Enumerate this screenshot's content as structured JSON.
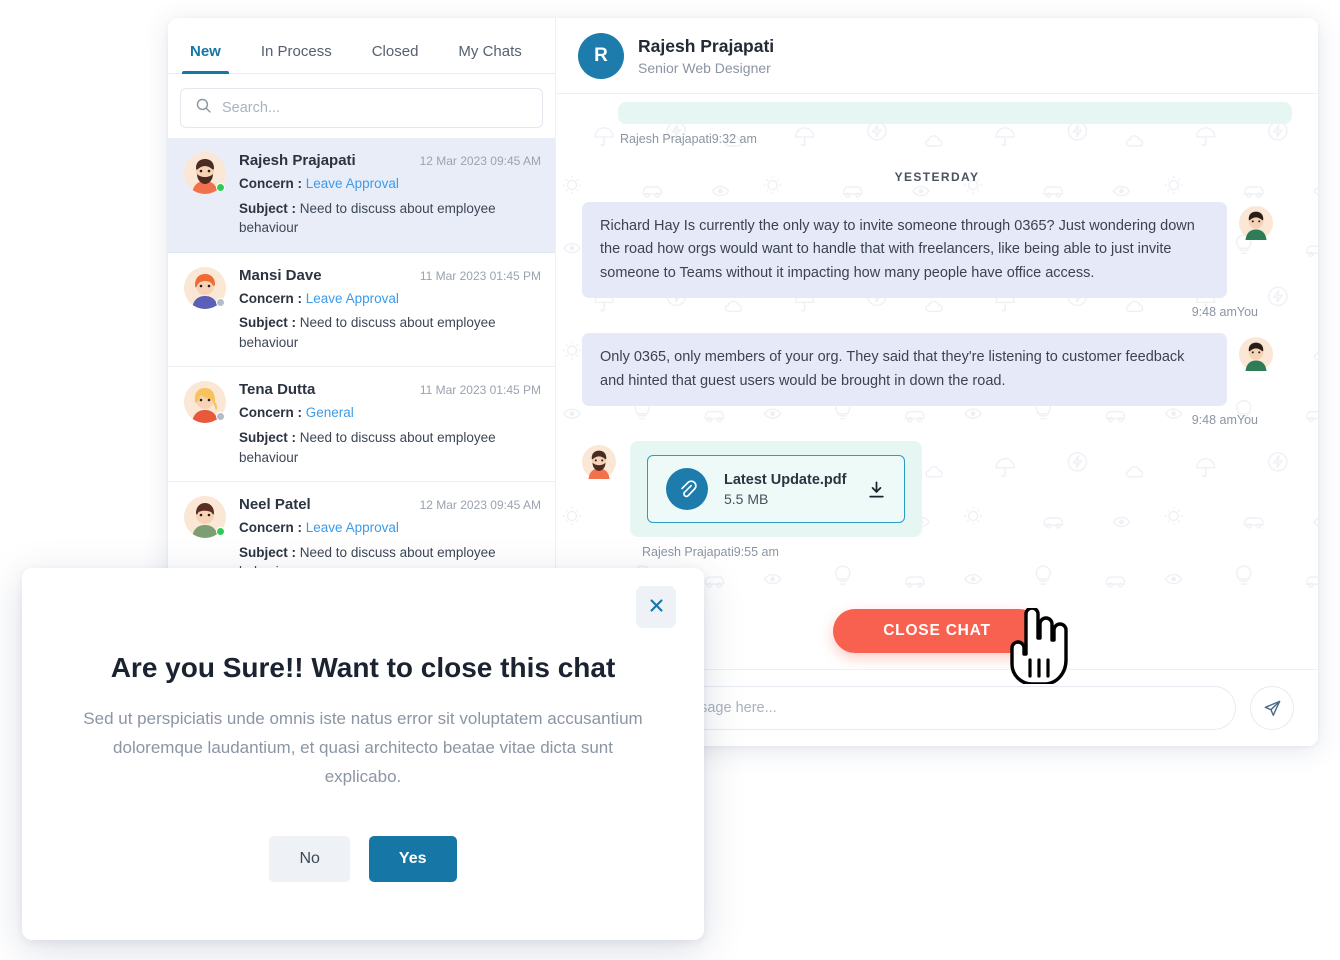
{
  "tabs": [
    {
      "label": "New",
      "active": true
    },
    {
      "label": "In Process",
      "active": false
    },
    {
      "label": "Closed",
      "active": false
    },
    {
      "label": "My Chats",
      "active": false
    }
  ],
  "search": {
    "placeholder": "Search...",
    "value": "",
    "icon": "search-icon"
  },
  "chat_list": {
    "concern_label": "Concern :",
    "subject_label": "Subject :",
    "items": [
      {
        "name": "Rajesh Prajapati",
        "time": "12 Mar 2023 09:45 AM",
        "concern": "Leave Approval",
        "subject": "Need to discuss about employee behaviour",
        "status": "online",
        "selected": true
      },
      {
        "name": "Mansi Dave",
        "time": "11 Mar 2023 01:45 PM",
        "concern": "Leave Approval",
        "subject": "Need to discuss about employee behaviour",
        "status": "offline",
        "selected": false
      },
      {
        "name": "Tena Dutta",
        "time": "11 Mar 2023 01:45 PM",
        "concern": "General",
        "subject": "Need to discuss about employee behaviour",
        "status": "offline",
        "selected": false
      },
      {
        "name": "Neel Patel",
        "time": "12 Mar 2023 09:45 AM",
        "concern": "Leave Approval",
        "subject": "Need to discuss about employee behaviour",
        "status": "online",
        "selected": false
      }
    ]
  },
  "chat_header": {
    "avatar_initial": "R",
    "name": "Rajesh Prajapati",
    "role": "Senior Web Designer"
  },
  "conversation": {
    "day_separator": "YESTERDAY",
    "meta_top": "Rajesh Prajapati9:32 am",
    "messages": [
      {
        "text": "Richard Hay Is currently the only way to invite someone through 0365? Just wondering down the road how orgs would want to handle that with freelancers, like being able to just invite someone to Teams without it impacting how many people have office access.",
        "meta": "9:48 amYou"
      },
      {
        "text": "Only 0365, only members of your org. They said that they're listening to customer feedback and hinted that guest users would be brought in down the road.",
        "meta": "9:48 amYou"
      }
    ],
    "attachment": {
      "file_name": "Latest Update.pdf",
      "file_size": "5.5 MB",
      "meta": "Rajesh Prajapati9:55 am",
      "icon": "paperclip-icon",
      "download_icon": "download-icon"
    }
  },
  "close_chat_button": {
    "label": "CLOSE CHAT",
    "color": "#f8604f"
  },
  "composer": {
    "placeholder": "Type your message here...",
    "value": "",
    "send_icon": "send-icon"
  },
  "modal": {
    "title": "Are you Sure!! Want to close this chat",
    "body": "Sed ut perspiciatis unde omnis iste natus error sit voluptatem accusantium doloremque laudantium, et quasi architecto beatae vitae dicta sunt explicabo.",
    "no_label": "No",
    "yes_label": "Yes",
    "close_icon": "close-x-icon"
  },
  "colors": {
    "accent_blue": "#1676a6",
    "link_blue": "#3c9bea",
    "danger_red": "#f8604f",
    "bubble_in": "#e6e9f8",
    "bubble_mint": "#e6f6f2",
    "selected_row": "#e9edf8",
    "online_green": "#2ecc55"
  },
  "cursor": {
    "type": "pointer-hand-cursor"
  }
}
